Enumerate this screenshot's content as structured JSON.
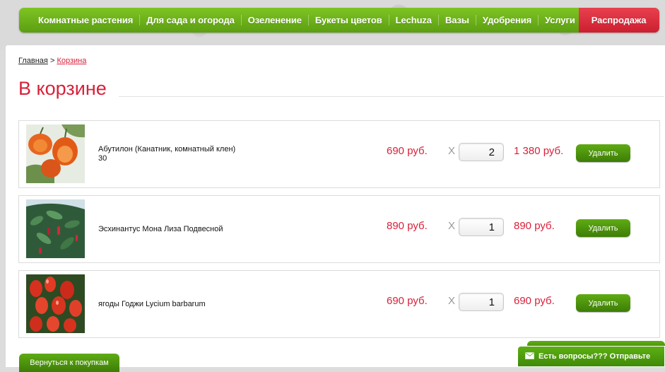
{
  "nav": {
    "items": [
      "Комнатные растения",
      "Для сада и огорода",
      "Озеленение",
      "Букеты цветов",
      "Lechuza",
      "Вазы",
      "Удобрения",
      "Услуги"
    ],
    "sale": "Распродажа",
    "sale_color": "#d8213a",
    "accent_color": "#6ab41c"
  },
  "breadcrumb": {
    "home": "Главная",
    "separator": ">",
    "current": "Корзина"
  },
  "page_title": "В корзине",
  "cart": {
    "items": [
      {
        "name": "Абутилон (Канатник, комнатный клен)",
        "note": "30",
        "price": "690 руб.",
        "times": "X",
        "qty": "2",
        "total": "1 380 руб.",
        "delete_label": "Удалить",
        "image": "abutilon-flower"
      },
      {
        "name": "Эсхинантус Мона Лиза Подвесной",
        "note": "",
        "price": "890 руб.",
        "times": "X",
        "qty": "1",
        "total": "890 руб.",
        "delete_label": "Удалить",
        "image": "aeschynanthus-plant"
      },
      {
        "name": "ягоды Годжи Lycium barbarum",
        "note": "",
        "price": "690 руб.",
        "times": "X",
        "qty": "1",
        "total": "690 руб.",
        "delete_label": "Удалить",
        "image": "goji-berries"
      }
    ]
  },
  "back_button": "Вернуться к покупкам",
  "chat": {
    "icon": "mail-icon",
    "label": "Есть вопросы??? Отправьте"
  }
}
